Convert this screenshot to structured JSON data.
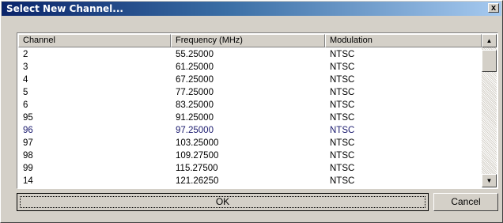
{
  "window": {
    "title": "Select New Channel...",
    "close_glyph": "x"
  },
  "table": {
    "columns": [
      "Channel",
      "Frequency (MHz)",
      "Modulation"
    ],
    "rows": [
      [
        "2",
        "55.25000",
        "NTSC"
      ],
      [
        "3",
        "61.25000",
        "NTSC"
      ],
      [
        "4",
        "67.25000",
        "NTSC"
      ],
      [
        "5",
        "77.25000",
        "NTSC"
      ],
      [
        "6",
        "83.25000",
        "NTSC"
      ],
      [
        "95",
        "91.25000",
        "NTSC"
      ],
      [
        "96",
        "97.25000",
        "NTSC"
      ],
      [
        "97",
        "103.25000",
        "NTSC"
      ],
      [
        "98",
        "109.27500",
        "NTSC"
      ],
      [
        "99",
        "115.27500",
        "NTSC"
      ],
      [
        "14",
        "121.26250",
        "NTSC"
      ]
    ],
    "highlighted_row": 6
  },
  "scrollbar": {
    "up_glyph": "▲",
    "down_glyph": "▼"
  },
  "buttons": {
    "ok": "OK",
    "cancel": "Cancel"
  }
}
